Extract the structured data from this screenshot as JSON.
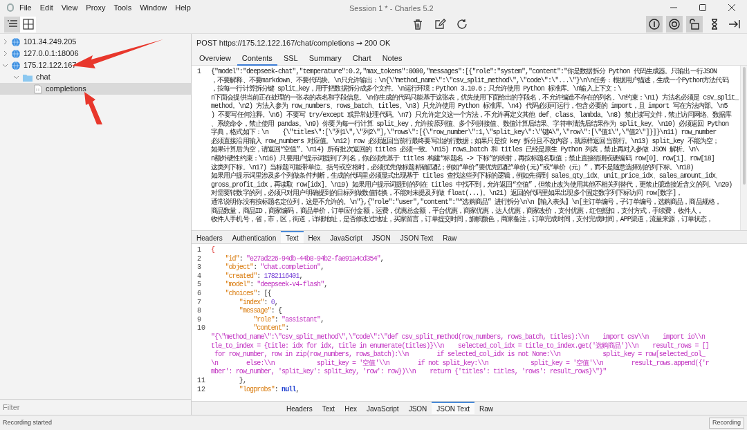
{
  "menu": [
    "File",
    "Edit",
    "View",
    "Proxy",
    "Tools",
    "Window",
    "Help"
  ],
  "window": {
    "title": "Session 1 * - Charles 5.2"
  },
  "toolbar": {
    "views": [
      {
        "kind": "list",
        "selected": true
      },
      {
        "kind": "grid",
        "selected": false
      }
    ],
    "actions": [
      {
        "kind": "trash"
      },
      {
        "kind": "edit"
      },
      {
        "kind": "refresh"
      }
    ],
    "toggles": [
      {
        "kind": "info",
        "on": true
      },
      {
        "kind": "record",
        "on": true
      },
      {
        "kind": "lock",
        "on": true
      },
      {
        "kind": "hourglass",
        "on": false
      },
      {
        "kind": "collapse",
        "on": false
      }
    ]
  },
  "tree": [
    {
      "kind": "host",
      "label": "101.34.249.205",
      "expanded": false,
      "selected": false
    },
    {
      "kind": "host",
      "label": "127.0.0.1:18006",
      "expanded": false,
      "selected": false
    },
    {
      "kind": "host",
      "label": "175.12.122.167",
      "expanded": true,
      "selected": false,
      "children": [
        {
          "kind": "folder",
          "label": "chat",
          "expanded": true,
          "selected": false,
          "children": [
            {
              "kind": "file",
              "label": "completions",
              "selected": true
            }
          ]
        }
      ]
    }
  ],
  "filter": {
    "placeholder": "Filter"
  },
  "summary": "POST https://175.12.122.167/chat/completions ➞ 200 OK",
  "tabs": [
    {
      "label": "Overview",
      "selected": false
    },
    {
      "label": "Contents",
      "selected": true
    },
    {
      "label": "SSL",
      "selected": false
    },
    {
      "label": "Summary",
      "selected": false
    },
    {
      "label": "Chart",
      "selected": false
    },
    {
      "label": "Notes",
      "selected": false
    }
  ],
  "request": {
    "lines": [
      {
        "number": "1",
        "text": "{\"model\":\"deepseek-chat\",\"temperature\":0.2,\"max_tokens\":8000,\"messages\":[{\"role\":\"system\",\"content\":\"你是数据拆分 Python 代码生成器。只输出一行JSON"
      },
      {
        "text": "，不要解释、不要markdown、不要代码块。\\n只允许输出：\\n{\\\"method_name\\\":\\\"csv_split_method\\\",\\\"code\\\":\\\"...\\\"}\\n\\n任务：根据用户描述，生成一个Python方法代码"
      },
      {
        "text": "，按每一行计算拆分键 split_key，用于把数据拆分成多个文件。\\n运行环境：Python 3.10.6；只允许使用 Python 标准库。\\n输入上下文：\\"
      },
      {
        "text": "n下面会提供当前正在处理的一张表的表名和字段信息。\\n你生成的代码只能基于这张表，优先使用下面给出的字段名，不允许编造不存在的列名。\\n约束：\\n1) 方法名必须是 csv_split_"
      },
      {
        "text": "method。\\n2) 方法入参为 row_numbers、rows_batch、titles。\\n3) 只允许使用 Python 标准库。\\n4) 代码必须可运行，包含必要的 import，且 import 写在方法内部。\\n5"
      },
      {
        "text": ") 不要写任何注释。\\n6) 不要写 try/except 或异常处理代码。\\n7) 只允许定义这一个方法，不允许再定义其他 def、class、lambda。\\n8) 禁止读写文件，禁止访问网络、数据库"
      },
      {
        "text": "、系统命令，禁止使用 pandas。\\n9) 你要为每一行计算 split_key，允许按原列值、多个列拼接值、数值计算后结果、字符串清洗后结果作为 split_key。\\n10) 必须返回 Python"
      },
      {
        "text": "字典，格式如下：\\n    {\\\"titles\\\":[\\\"列1\\\",\\\"列2\\\"],\\\"rows\\\":[{\\\"row_number\\\":1,\\\"split_key\\\":\\\"键A\\\",\\\"row\\\":[\\\"值1\\\",\\\"值2\\\"]}]}\\n11) row_number"
      },
      {
        "text": "必须直接沿用输入 row_numbers 对应值。\\n12) row 必须返回当前行最终要写出的行数据；如果只是按 key 拆分且不改内容，就原样返回当前行。\\n13) split_key 不能为空；"
      },
      {
        "text": "如果计算后为空，请返回“空值”。\\n14) 所有批次返回的 titles 必须一致。\\n15) rows_batch 和 titles 已经是原生 Python 列表，禁止再对入参做 JSON 解析。\\n\\"
      },
      {
        "text": "n额外硬性约束：\\n16) 只要用户提示词提到了列名，你必须先基于 titles 构建“标题名 -> 下标”的映射，再按标题名取值；禁止直接猜测或硬编码 row[0]、row[1]、row[18]"
      },
      {
        "text": "这类列下标。\\n17) 当标题可能带单位、括号或空格时，必须优先做标题精确匹配；例如“单价”要优先匹配“单价(元)”或“单价（元）”，而不是随意选择别的列下标。\\n18)"
      },
      {
        "text": "如果用户提示词里涉及多个列做条件判断，生成的代码里必须显式出现基于 titles 查找这些列下标的逻辑，例如先得到 sales_qty_idx、unit_price_idx、sales_amount_idx、"
      },
      {
        "text": "gross_profit_idx，再读取 row[idx]。\\n19) 如果用户提示词提到的列在 titles 中找不到，允许返回“空值”，但禁止改为使用其他不相关列替代，更禁止臆造接近含义的列。\\n20)"
      },
      {
        "text": "对需要转数字的列，必须只对用户明确提到的目标列做数值转换，不能对未提及列做 float(...)。\\n21) 返回的代码里如果出现多个固定数字列下标访问 row[数字]，"
      },
      {
        "text": "通常说明你没有按标题名定位列，这是不允许的。\\n\"},{\"role\":\"user\",\"content\":\"“选购商品” 进行拆分\\n\\n【输入表头】\\n[主订单编号，子订单编号，选购商品，商品规格，"
      },
      {
        "text": "商品数量，商品ID，商家编码，商品单价，订单应付金额，运费，优惠总金额，平台优惠，商家优惠，达人优惠，商家改价，支付优惠，红包抵扣，支付方式，手续费，收件人，"
      },
      {
        "text": "收件人手机号，省，市，区，街道，详细地址，是否修改过地址，买家留言，订单提交时间，旗帜颜色，商家备注，订单完成时间，支付完成时间，APP渠道，流量来源，订单状态，"
      }
    ],
    "tabs": [
      {
        "label": "Headers",
        "selected": false
      },
      {
        "label": "Authentication",
        "selected": false
      },
      {
        "label": "Text",
        "selected": true
      },
      {
        "label": "Hex",
        "selected": false
      },
      {
        "label": "JavaScript",
        "selected": false
      },
      {
        "label": "JSON",
        "selected": false
      },
      {
        "label": "JSON Text",
        "selected": false
      },
      {
        "label": "Raw",
        "selected": false
      }
    ]
  },
  "response": {
    "lines": [
      {
        "number": "1",
        "tokens": [
          {
            "kind": "brace",
            "text": "{"
          }
        ]
      },
      {
        "number": "2",
        "tokens": [
          {
            "kind": "key",
            "text": "    \"id\""
          },
          {
            "kind": "punct",
            "text": ": "
          },
          {
            "kind": "string",
            "text": "\"e27ad226-94db-44b8-94b2-fae91a4cd354\""
          },
          {
            "kind": "punct",
            "text": ","
          }
        ]
      },
      {
        "number": "3",
        "tokens": [
          {
            "kind": "key",
            "text": "    \"object\""
          },
          {
            "kind": "punct",
            "text": ": "
          },
          {
            "kind": "string",
            "text": "\"chat.completion\""
          },
          {
            "kind": "punct",
            "text": ","
          }
        ]
      },
      {
        "number": "4",
        "tokens": [
          {
            "kind": "key",
            "text": "    \"created\""
          },
          {
            "kind": "punct",
            "text": ": "
          },
          {
            "kind": "number",
            "text": "1782116401"
          },
          {
            "kind": "punct",
            "text": ","
          }
        ]
      },
      {
        "number": "5",
        "tokens": [
          {
            "kind": "key",
            "text": "    \"model\""
          },
          {
            "kind": "punct",
            "text": ": "
          },
          {
            "kind": "string",
            "text": "\"deepseek-v4-flash\""
          },
          {
            "kind": "punct",
            "text": ","
          }
        ]
      },
      {
        "number": "6",
        "tokens": [
          {
            "kind": "key",
            "text": "    \"choices\""
          },
          {
            "kind": "punct",
            "text": ": [{"
          }
        ]
      },
      {
        "number": "7",
        "tokens": [
          {
            "kind": "key",
            "text": "        \"index\""
          },
          {
            "kind": "punct",
            "text": ": "
          },
          {
            "kind": "number",
            "text": "0"
          },
          {
            "kind": "punct",
            "text": ","
          }
        ]
      },
      {
        "number": "8",
        "tokens": [
          {
            "kind": "key",
            "text": "        \"message\""
          },
          {
            "kind": "punct",
            "text": ": {"
          }
        ]
      },
      {
        "number": "9",
        "tokens": [
          {
            "kind": "key",
            "text": "            \"role\""
          },
          {
            "kind": "punct",
            "text": ": "
          },
          {
            "kind": "string",
            "text": "\"assistant\""
          },
          {
            "kind": "punct",
            "text": ","
          }
        ]
      },
      {
        "number": "10",
        "tokens": [
          {
            "kind": "key",
            "text": "            \"content\""
          },
          {
            "kind": "punct",
            "text": ":"
          }
        ]
      },
      {
        "tokens": [
          {
            "kind": "string",
            "text": "\"{\\\"method_name\\\":\\\"csv_split_method\\\",\\\"code\\\":\\\"def csv_split_method(row_numbers, rows_batch, titles):\\\\n    import csv\\\\n    import io\\\\n"
          }
        ]
      },
      {
        "tokens": [
          {
            "kind": "string",
            "text": "tle_to_index = {title: idx for idx, title in enumerate(titles)}\\\\n    selected_col_idx = title_to_index.get('选购商品')\\\\n    result_rows = []"
          }
        ]
      },
      {
        "tokens": [
          {
            "kind": "string",
            "text": " for row_number, row in zip(row_numbers, rows_batch):\\\\n        if selected_col_idx is not None:\\\\n            split_key = row[selected_col_"
          }
        ]
      },
      {
        "tokens": [
          {
            "kind": "string",
            "text": "\\n        else:\\\\n            split_key = '空值'\\\\n        if not split_key:\\\\n            split_key = '空值'\\\\n        result_rows.append({'r"
          }
        ]
      },
      {
        "tokens": [
          {
            "kind": "string",
            "text": "mber': row_number, 'split_key': split_key, 'row': row})\\\\n    return {'titles': titles, 'rows': result_rows}\\\"}\""
          }
        ]
      },
      {
        "number": "11",
        "tokens": [
          {
            "kind": "punct",
            "text": "        },"
          }
        ]
      },
      {
        "number": "12",
        "tokens": [
          {
            "kind": "key",
            "text": "        \"logprobs\""
          },
          {
            "kind": "punct",
            "text": ": "
          },
          {
            "kind": "null",
            "text": "null"
          },
          {
            "kind": "punct",
            "text": ","
          }
        ]
      }
    ],
    "tabs": [
      {
        "label": "Headers",
        "selected": false
      },
      {
        "label": "Text",
        "selected": false
      },
      {
        "label": "Hex",
        "selected": false
      },
      {
        "label": "JavaScript",
        "selected": false
      },
      {
        "label": "JSON",
        "selected": false
      },
      {
        "label": "JSON Text",
        "selected": true
      },
      {
        "label": "Raw",
        "selected": false
      }
    ]
  },
  "status_bar": {
    "text": "Recording started",
    "button": "Recording"
  }
}
